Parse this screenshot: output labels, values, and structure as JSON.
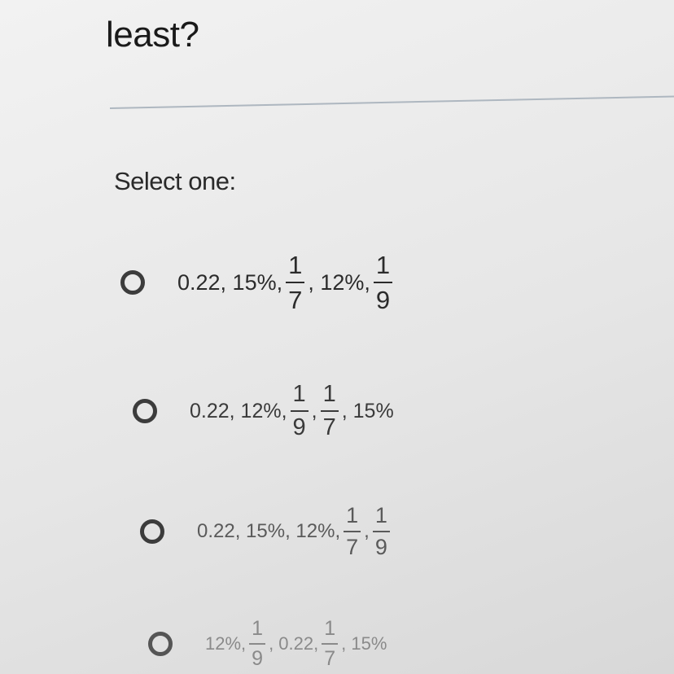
{
  "question": {
    "text": "least?"
  },
  "prompt": "Select one:",
  "options": [
    {
      "id": "a",
      "parts": [
        {
          "type": "text",
          "value": "0.22, 15%,"
        },
        {
          "type": "frac",
          "num": "1",
          "den": "7"
        },
        {
          "type": "text",
          "value": ", 12%,"
        },
        {
          "type": "frac",
          "num": "1",
          "den": "9"
        }
      ]
    },
    {
      "id": "b",
      "parts": [
        {
          "type": "text",
          "value": "0.22, 12%,"
        },
        {
          "type": "frac",
          "num": "1",
          "den": "9"
        },
        {
          "type": "text",
          "value": ","
        },
        {
          "type": "frac",
          "num": "1",
          "den": "7"
        },
        {
          "type": "text",
          "value": ", 15%"
        }
      ]
    },
    {
      "id": "c",
      "parts": [
        {
          "type": "text",
          "value": "0.22, 15%, 12%,"
        },
        {
          "type": "frac",
          "num": "1",
          "den": "7"
        },
        {
          "type": "text",
          "value": ","
        },
        {
          "type": "frac",
          "num": "1",
          "den": "9"
        }
      ]
    },
    {
      "id": "d",
      "parts": [
        {
          "type": "text",
          "value": "12%,"
        },
        {
          "type": "frac",
          "num": "1",
          "den": "9"
        },
        {
          "type": "text",
          "value": ", 0.22,"
        },
        {
          "type": "frac",
          "num": "1",
          "den": "7"
        },
        {
          "type": "text",
          "value": ", 15%"
        }
      ]
    }
  ]
}
